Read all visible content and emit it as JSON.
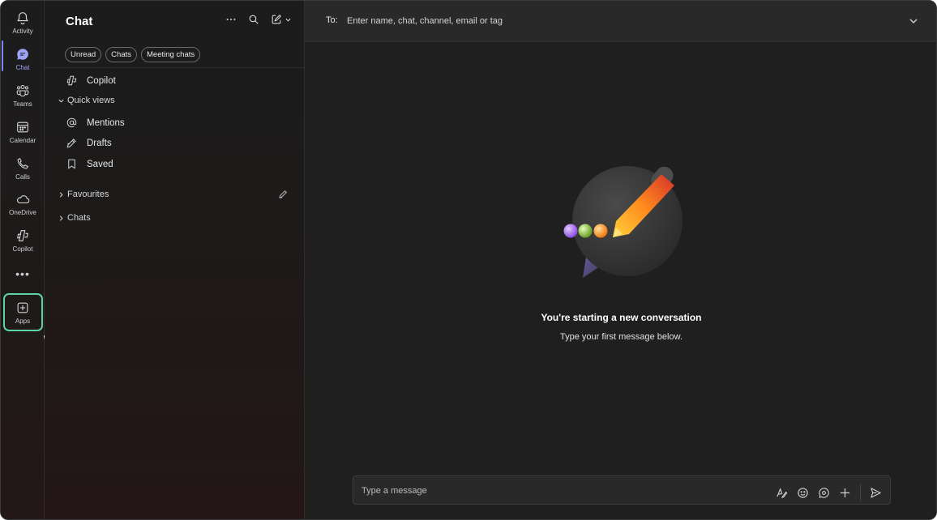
{
  "rail": {
    "items": [
      {
        "label": "Activity",
        "icon": "bell-icon"
      },
      {
        "label": "Chat",
        "icon": "chat-icon"
      },
      {
        "label": "Teams",
        "icon": "teams-icon"
      },
      {
        "label": "Calendar",
        "icon": "calendar-icon"
      },
      {
        "label": "Calls",
        "icon": "phone-icon"
      },
      {
        "label": "OneDrive",
        "icon": "cloud-icon"
      },
      {
        "label": "Copilot",
        "icon": "copilot-icon"
      },
      {
        "label": "Apps",
        "icon": "plus-square-icon"
      }
    ],
    "more": "•••"
  },
  "list": {
    "title": "Chat",
    "filters": [
      "Unread",
      "Chats",
      "Meeting chats"
    ],
    "copilot": "Copilot",
    "quick_views": "Quick views",
    "mentions": "Mentions",
    "drafts": "Drafts",
    "saved": "Saved",
    "favourites": "Favourites",
    "chats": "Chats"
  },
  "main": {
    "to_label": "To:",
    "to_placeholder": "Enter name, chat, channel, email or tag",
    "empty_title": "You're starting a new conversation",
    "empty_subtitle": "Type your first message below.",
    "composer_placeholder": "Type a message"
  },
  "colors": {
    "accent": "#7f85f5",
    "highlight": "#5fd3a0",
    "cursor": "#8a5cf6"
  }
}
